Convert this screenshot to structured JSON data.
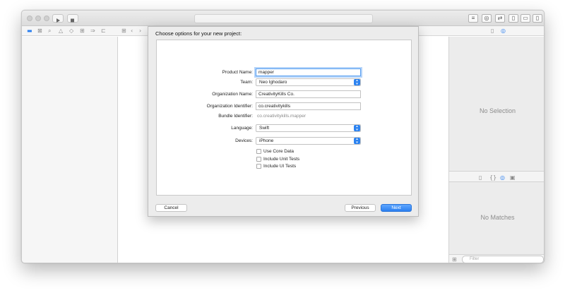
{
  "toolbar": {
    "run_icon": "play-icon",
    "stop_icon": "stop-icon",
    "activity_text": ""
  },
  "navigator": {
    "icons": [
      "folder-icon",
      "source-control-icon",
      "search-icon",
      "warning-icon",
      "breakpoint-icon",
      "tests-icon",
      "debug-icon",
      "report-icon"
    ]
  },
  "sheet": {
    "title": "Choose options for your new project:",
    "fields": {
      "product_name_label": "Product Name:",
      "product_name_value": "mapper",
      "team_label": "Team:",
      "team_value": "Neo Ighodaro",
      "org_name_label": "Organization Name:",
      "org_name_value": "CreativityKills Co.",
      "org_id_label": "Organization Identifier:",
      "org_id_value": "co.creativitykills",
      "bundle_id_label": "Bundle Identifier:",
      "bundle_id_value": "co.creativitykills.mapper",
      "language_label": "Language:",
      "language_value": "Swift",
      "devices_label": "Devices:",
      "devices_value": "iPhone"
    },
    "checkboxes": [
      {
        "label": "Use Core Data",
        "checked": false
      },
      {
        "label": "Include Unit Tests",
        "checked": false
      },
      {
        "label": "Include UI Tests",
        "checked": false
      }
    ],
    "buttons": {
      "cancel": "Cancel",
      "previous": "Previous",
      "next": "Next"
    }
  },
  "inspector": {
    "no_selection": "No Selection",
    "no_matches": "No Matches",
    "filter_placeholder": "Filter"
  },
  "colors": {
    "accent": "#2b7ff0",
    "focus_ring": "#5aa0f2"
  }
}
